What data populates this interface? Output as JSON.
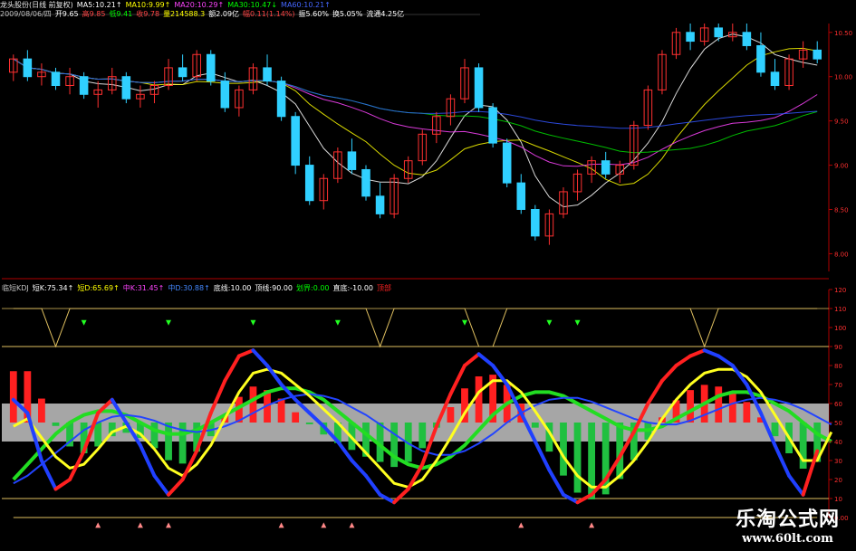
{
  "header": {
    "line1": [
      {
        "text": "龙头股份(日线 前复权)",
        "color": "#e8e8e8"
      },
      {
        "text": "MA5:10.21↑",
        "color": "#ffffff"
      },
      {
        "text": "MA10:9.99↑",
        "color": "#ffff00"
      },
      {
        "text": "MA20:10.29↑",
        "color": "#ff44ff"
      },
      {
        "text": "MA30:10.47↓",
        "color": "#00ff00"
      },
      {
        "text": "MA60:10.21↑",
        "color": "#4466ff"
      }
    ],
    "line2": [
      {
        "text": "2009/08/06/四",
        "color": "#c0c0c0"
      },
      {
        "text": "开9.65",
        "color": "#ffffff"
      },
      {
        "text": "高9.85",
        "color": "#ff4444"
      },
      {
        "text": "低9.41",
        "color": "#00ff00"
      },
      {
        "text": "收9.78",
        "color": "#ff4444"
      },
      {
        "text": "量214588.3",
        "color": "#ffff00"
      },
      {
        "text": "额2.09亿",
        "color": "#ffffff"
      },
      {
        "text": "幅0.11(1.14%)",
        "color": "#ff4444"
      },
      {
        "text": "振5.60%",
        "color": "#ffffff"
      },
      {
        "text": "换5.05%",
        "color": "#ffffff"
      },
      {
        "text": "流通4.25亿",
        "color": "#ffffff"
      }
    ],
    "line3": [
      {
        "text": "临短KDJ",
        "color": "#c0c0c0"
      },
      {
        "text": "短K:75.34↑",
        "color": "#ffffff"
      },
      {
        "text": "短D:65.69↑",
        "color": "#ffff00"
      },
      {
        "text": "中K:31.45↑",
        "color": "#ff44ff"
      },
      {
        "text": "中D:30.88↑",
        "color": "#4488ff"
      },
      {
        "text": "底线:10.00",
        "color": "#ffffff"
      },
      {
        "text": "顶线:90.00",
        "color": "#ffffff"
      },
      {
        "text": "划界:0.00",
        "color": "#00ff00"
      },
      {
        "text": "直底:-10.00",
        "color": "#ffffff"
      },
      {
        "text": "顶部",
        "color": "#ff2222"
      }
    ]
  },
  "price_axis": [
    "10.50",
    "10.00",
    "9.50",
    "9.00",
    "8.50",
    "8.00"
  ],
  "ind_axis": [
    "120",
    "110",
    "100",
    "90",
    "80",
    "70",
    "60",
    "50",
    "40",
    "30",
    "20",
    "10",
    "0.00"
  ],
  "watermark": {
    "title": "乐淘公式网",
    "url": "www.60lt.com"
  },
  "chart_data": [
    {
      "type": "candlestick",
      "ylim": [
        7.8,
        10.6
      ],
      "candles": [
        [
          10.05,
          10.25,
          9.95,
          10.2
        ],
        [
          10.2,
          10.3,
          9.95,
          10.0
        ],
        [
          10.0,
          10.15,
          9.9,
          10.05
        ],
        [
          10.05,
          10.1,
          9.85,
          9.9
        ],
        [
          9.9,
          10.1,
          9.8,
          10.0
        ],
        [
          10.0,
          10.05,
          9.75,
          9.8
        ],
        [
          9.8,
          9.95,
          9.65,
          9.85
        ],
        [
          9.85,
          10.1,
          9.8,
          10.0
        ],
        [
          10.0,
          10.05,
          9.7,
          9.75
        ],
        [
          9.75,
          9.9,
          9.65,
          9.8
        ],
        [
          9.8,
          9.95,
          9.7,
          9.9
        ],
        [
          9.9,
          10.2,
          9.85,
          10.1
        ],
        [
          10.1,
          10.25,
          9.95,
          10.0
        ],
        [
          10.0,
          10.3,
          9.95,
          10.25
        ],
        [
          10.25,
          10.3,
          9.9,
          9.95
        ],
        [
          9.95,
          10.05,
          9.6,
          9.65
        ],
        [
          9.65,
          9.9,
          9.55,
          9.85
        ],
        [
          9.85,
          10.15,
          9.8,
          10.1
        ],
        [
          10.1,
          10.25,
          9.9,
          9.95
        ],
        [
          9.95,
          10.0,
          9.5,
          9.55
        ],
        [
          9.55,
          9.6,
          8.9,
          9.0
        ],
        [
          9.0,
          9.1,
          8.55,
          8.6
        ],
        [
          8.6,
          8.9,
          8.5,
          8.85
        ],
        [
          8.85,
          9.2,
          8.8,
          9.15
        ],
        [
          9.15,
          9.3,
          8.9,
          8.95
        ],
        [
          8.95,
          9.0,
          8.6,
          8.65
        ],
        [
          8.65,
          8.8,
          8.4,
          8.45
        ],
        [
          8.45,
          8.9,
          8.4,
          8.85
        ],
        [
          8.85,
          9.1,
          8.8,
          9.05
        ],
        [
          9.05,
          9.4,
          9.0,
          9.35
        ],
        [
          9.35,
          9.6,
          9.25,
          9.55
        ],
        [
          9.55,
          9.8,
          9.45,
          9.75
        ],
        [
          9.75,
          10.2,
          9.7,
          10.1
        ],
        [
          10.1,
          10.15,
          9.6,
          9.65
        ],
        [
          9.65,
          9.7,
          9.2,
          9.25
        ],
        [
          9.25,
          9.3,
          8.75,
          8.8
        ],
        [
          8.8,
          8.9,
          8.45,
          8.5
        ],
        [
          8.5,
          8.55,
          8.15,
          8.2
        ],
        [
          8.2,
          8.5,
          8.1,
          8.45
        ],
        [
          8.45,
          8.75,
          8.4,
          8.7
        ],
        [
          8.7,
          8.95,
          8.6,
          8.9
        ],
        [
          8.9,
          9.1,
          8.8,
          9.05
        ],
        [
          9.05,
          9.15,
          8.85,
          8.9
        ],
        [
          8.9,
          9.05,
          8.8,
          9.0
        ],
        [
          9.0,
          9.5,
          8.95,
          9.45
        ],
        [
          9.45,
          9.9,
          9.4,
          9.85
        ],
        [
          9.85,
          10.3,
          9.8,
          10.25
        ],
        [
          10.25,
          10.55,
          10.2,
          10.5
        ],
        [
          10.5,
          10.6,
          10.3,
          10.4
        ],
        [
          10.4,
          10.6,
          10.35,
          10.55
        ],
        [
          10.55,
          10.6,
          10.4,
          10.45
        ],
        [
          10.45,
          10.6,
          10.4,
          10.5
        ],
        [
          10.5,
          10.6,
          10.3,
          10.35
        ],
        [
          10.35,
          10.5,
          10.0,
          10.05
        ],
        [
          10.05,
          10.2,
          9.85,
          9.9
        ],
        [
          9.9,
          10.25,
          9.85,
          10.2
        ],
        [
          10.2,
          10.4,
          10.1,
          10.3
        ],
        [
          10.3,
          10.4,
          10.15,
          10.2
        ]
      ]
    },
    {
      "type": "line",
      "title": "临短KDJ",
      "ylim": [
        0,
        120
      ],
      "guides": [
        10,
        90
      ],
      "series": [
        {
          "name": "短K",
          "values": [
            62,
            55,
            30,
            15,
            20,
            35,
            55,
            62,
            50,
            38,
            22,
            12,
            20,
            35,
            55,
            72,
            85,
            88,
            80,
            70,
            62,
            55,
            48,
            40,
            30,
            22,
            12,
            8,
            15,
            28,
            48,
            65,
            80,
            86,
            80,
            70,
            55,
            40,
            25,
            12,
            8,
            12,
            20,
            32,
            45,
            60,
            72,
            80,
            85,
            88,
            85,
            80,
            70,
            55,
            38,
            22,
            12,
            35,
            75
          ]
        },
        {
          "name": "短D",
          "values": [
            48,
            52,
            42,
            32,
            26,
            28,
            36,
            45,
            48,
            44,
            36,
            26,
            22,
            28,
            38,
            52,
            66,
            76,
            78,
            76,
            70,
            64,
            57,
            50,
            42,
            34,
            26,
            18,
            16,
            20,
            30,
            42,
            55,
            66,
            72,
            72,
            66,
            56,
            45,
            32,
            22,
            16,
            16,
            22,
            30,
            40,
            52,
            62,
            70,
            76,
            78,
            78,
            74,
            66,
            54,
            42,
            30,
            30,
            45
          ]
        },
        {
          "name": "中K",
          "values": [
            20,
            28,
            36,
            44,
            50,
            54,
            56,
            56,
            54,
            50,
            46,
            44,
            44,
            46,
            50,
            54,
            58,
            62,
            66,
            68,
            68,
            66,
            62,
            56,
            50,
            44,
            38,
            32,
            28,
            26,
            28,
            32,
            38,
            46,
            54,
            60,
            64,
            66,
            66,
            64,
            60,
            56,
            52,
            48,
            46,
            46,
            48,
            52,
            56,
            60,
            64,
            66,
            66,
            64,
            60,
            56,
            50,
            44,
            40
          ]
        },
        {
          "name": "中D",
          "values": [
            18,
            22,
            28,
            34,
            40,
            46,
            50,
            53,
            54,
            53,
            51,
            48,
            46,
            45,
            46,
            48,
            51,
            55,
            59,
            62,
            64,
            65,
            64,
            62,
            58,
            54,
            49,
            44,
            39,
            35,
            33,
            33,
            35,
            39,
            44,
            50,
            55,
            59,
            62,
            63,
            63,
            61,
            58,
            55,
            52,
            50,
            49,
            49,
            51,
            54,
            57,
            60,
            62,
            63,
            62,
            60,
            57,
            53,
            49
          ]
        }
      ]
    }
  ]
}
